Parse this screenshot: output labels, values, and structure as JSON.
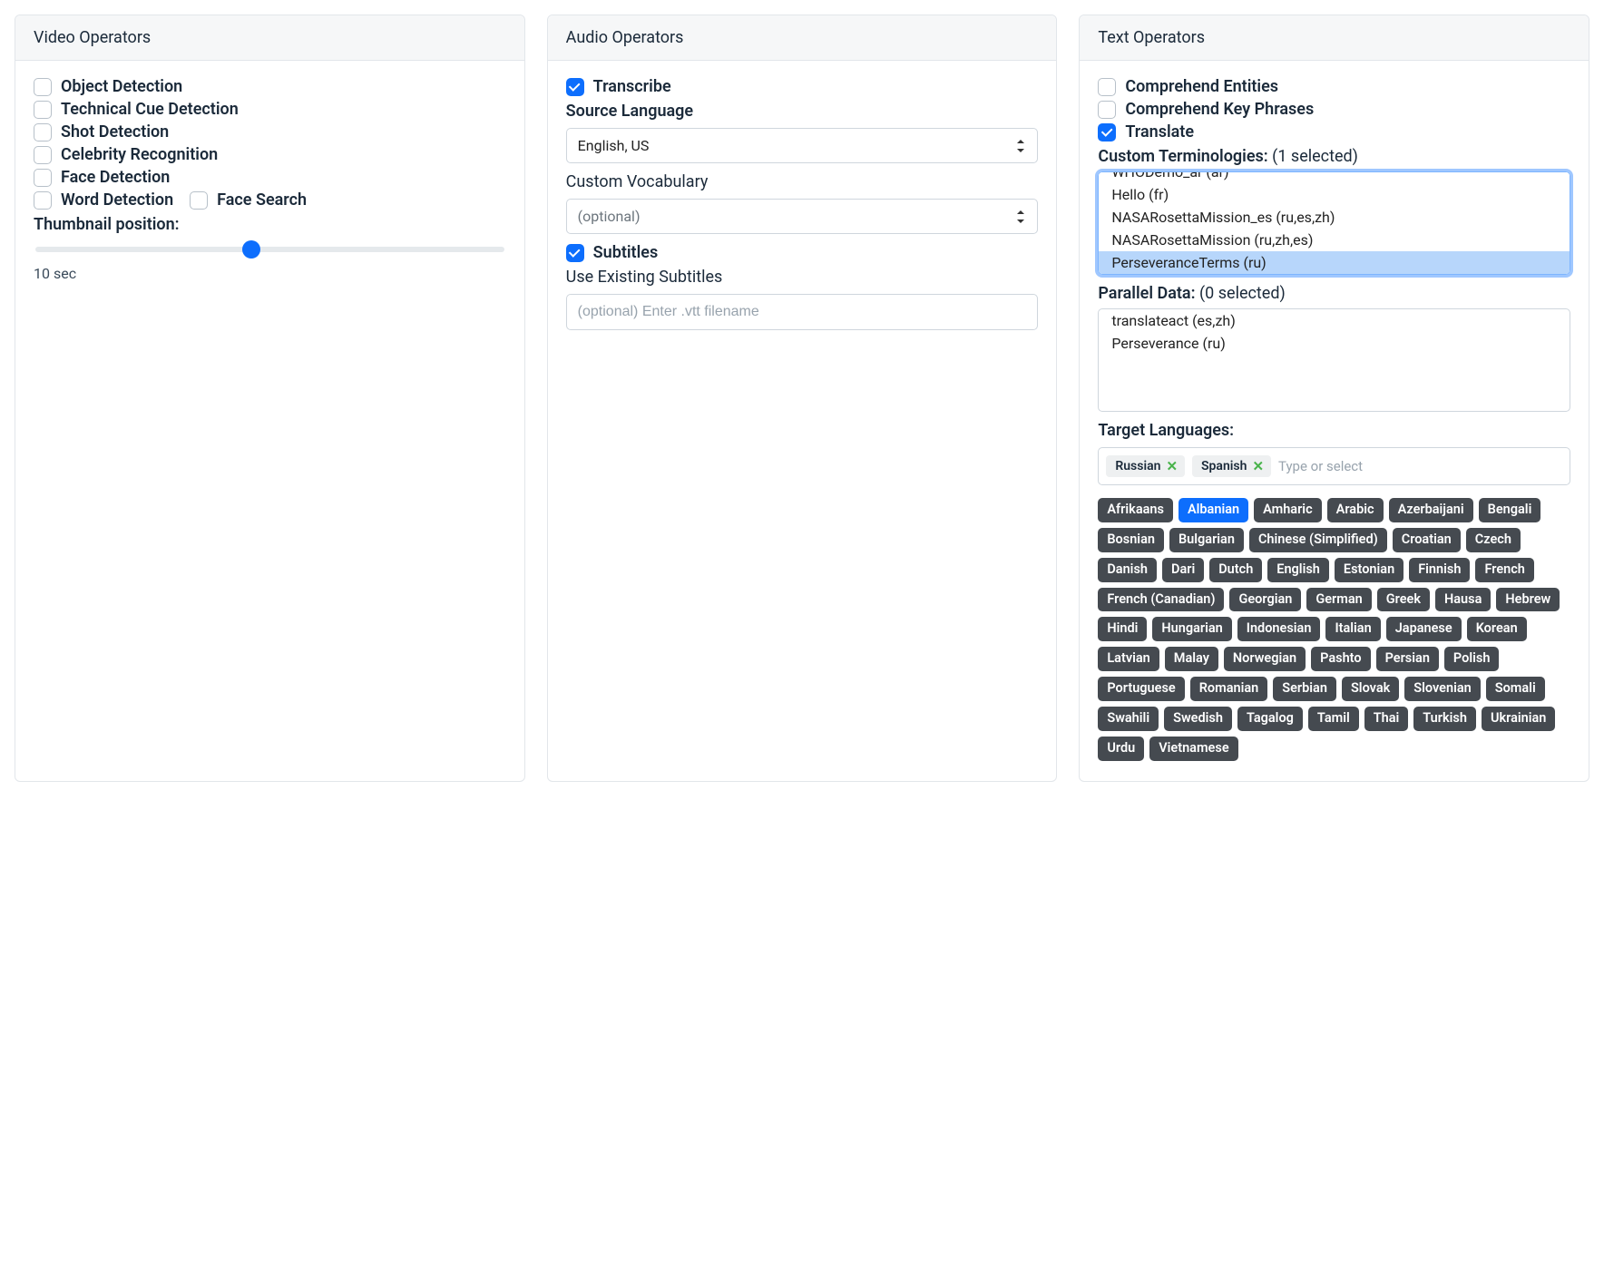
{
  "video": {
    "title": "Video Operators",
    "checkboxes": {
      "object_detection": "Object Detection",
      "technical_cue": "Technical Cue Detection",
      "shot_detection": "Shot Detection",
      "celebrity_recognition": "Celebrity Recognition",
      "face_detection": "Face Detection",
      "word_detection": "Word Detection",
      "face_search": "Face Search"
    },
    "thumbnail_label": "Thumbnail position:",
    "thumbnail_value_text": "10 sec",
    "thumbnail_percent": 46
  },
  "audio": {
    "title": "Audio Operators",
    "transcribe_label": "Transcribe",
    "source_language_label": "Source Language",
    "source_language_value": "English, US",
    "custom_vocab_label": "Custom Vocabulary",
    "custom_vocab_placeholder": "(optional)",
    "subtitles_label": "Subtitles",
    "use_existing_label": "Use Existing Subtitles",
    "subtitles_input_placeholder": "(optional) Enter .vtt filename"
  },
  "text": {
    "title": "Text Operators",
    "comprehend_entities": "Comprehend Entities",
    "comprehend_key_phrases": "Comprehend Key Phrases",
    "translate": "Translate",
    "custom_term_label": "Custom Terminologies:",
    "custom_term_count": "(1 selected)",
    "custom_term_options": [
      "WHODemo_ar (ar)",
      "Hello (fr)",
      "NASARosettaMission_es (ru,es,zh)",
      "NASARosettaMission (ru,zh,es)",
      "PerseveranceTerms (ru)"
    ],
    "custom_term_selected_index": 4,
    "parallel_label": "Parallel Data:",
    "parallel_count": "(0 selected)",
    "parallel_options": [
      "translateact (es,zh)",
      "Perseverance (ru)"
    ],
    "target_languages_label": "Target Languages:",
    "selected_tags": [
      "Russian",
      "Spanish"
    ],
    "tags_placeholder": "Type or select",
    "languages_active": "Albanian",
    "languages": [
      "Afrikaans",
      "Albanian",
      "Amharic",
      "Arabic",
      "Azerbaijani",
      "Bengali",
      "Bosnian",
      "Bulgarian",
      "Chinese (Simplified)",
      "Croatian",
      "Czech",
      "Danish",
      "Dari",
      "Dutch",
      "English",
      "Estonian",
      "Finnish",
      "French",
      "French (Canadian)",
      "Georgian",
      "German",
      "Greek",
      "Hausa",
      "Hebrew",
      "Hindi",
      "Hungarian",
      "Indonesian",
      "Italian",
      "Japanese",
      "Korean",
      "Latvian",
      "Malay",
      "Norwegian",
      "Pashto",
      "Persian",
      "Polish",
      "Portuguese",
      "Romanian",
      "Serbian",
      "Slovak",
      "Slovenian",
      "Somali",
      "Swahili",
      "Swedish",
      "Tagalog",
      "Tamil",
      "Thai",
      "Turkish",
      "Ukrainian",
      "Urdu",
      "Vietnamese"
    ]
  }
}
